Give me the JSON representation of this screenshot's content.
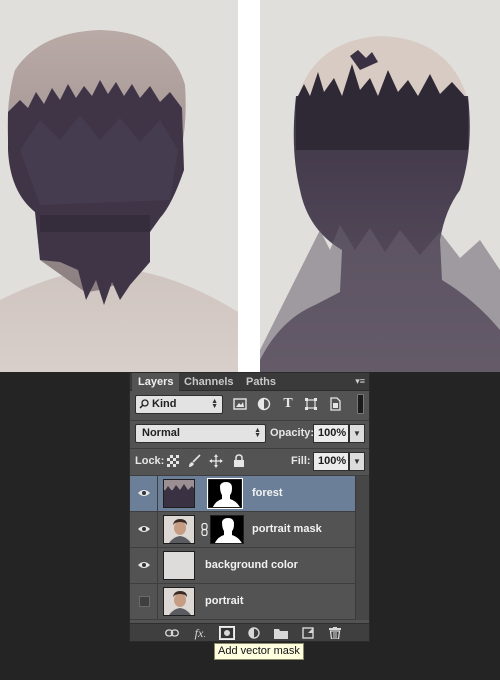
{
  "layers_panel": {
    "tabs": [
      "Layers",
      "Channels",
      "Paths"
    ],
    "active_tab": "Layers",
    "filter": {
      "kind_label": "Kind",
      "icons": [
        "pixel-filter-icon",
        "adjustment-filter-icon",
        "type-filter-icon",
        "shape-filter-icon",
        "smart-object-filter-icon"
      ]
    },
    "blend_mode": "Normal",
    "opacity_label": "Opacity:",
    "opacity_value": "100%",
    "lock_label": "Lock:",
    "fill_label": "Fill:",
    "fill_value": "100%",
    "layers": [
      {
        "name": "forest",
        "visible": true,
        "selected": true,
        "has_mask": true
      },
      {
        "name": "portrait mask",
        "visible": true,
        "selected": false,
        "has_mask": true
      },
      {
        "name": "background color",
        "visible": true,
        "selected": false,
        "has_mask": false
      },
      {
        "name": "portrait",
        "visible": false,
        "selected": false,
        "has_mask": false
      }
    ],
    "footer_icons": [
      "link-layers-icon",
      "fx-icon",
      "add-mask-icon",
      "adjustment-layer-icon",
      "new-group-icon",
      "new-layer-icon",
      "trash-icon"
    ],
    "tooltip": "Add vector mask"
  },
  "colors": {
    "panel": "#535353",
    "selected_row": "#6b7f99",
    "art_background": "#e1dfdc"
  }
}
